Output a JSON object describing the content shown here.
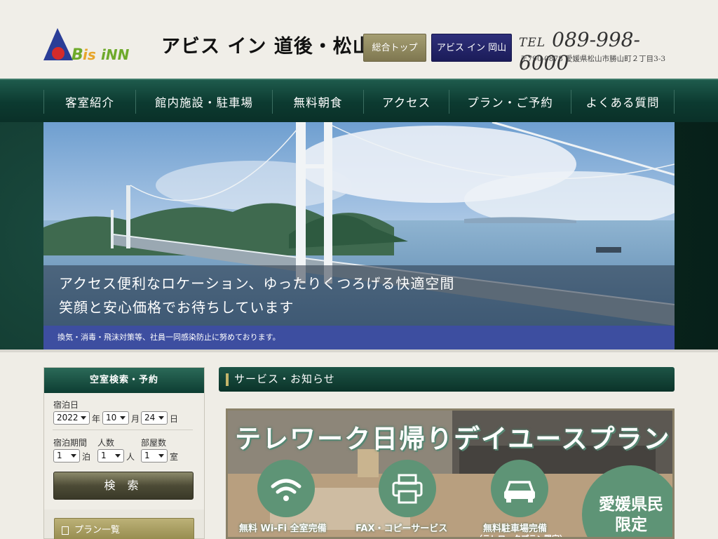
{
  "header": {
    "logo_text": "アビス イン 道後・松山",
    "logo_mark": "ABiS iNN",
    "btn_top": "総合トップ",
    "btn_okayama": "アビス イン 岡山",
    "tel_label": "TEL",
    "tel_number": "089-998-6000",
    "address": "〒790-0878  愛媛県松山市勝山町２丁目3-3"
  },
  "nav": {
    "items": [
      {
        "label": "客室紹介"
      },
      {
        "label": "館内施設・駐車場"
      },
      {
        "label": "無料朝食"
      },
      {
        "label": "アクセス"
      },
      {
        "label": "プラン・ご予約"
      },
      {
        "label": "よくある質問"
      }
    ]
  },
  "hero": {
    "line1": "アクセス便利なロケーション、ゆったりくつろげる快適空間",
    "line2": "笑顔と安心価格でお待ちしています",
    "notice": "換気・消毒・飛沫対策等、社員一同感染防止に努めております。"
  },
  "sidebar": {
    "title": "空室検索・予約",
    "checkin_label": "宿泊日",
    "year": "2022",
    "year_unit": "年",
    "month": "10",
    "month_unit": "月",
    "day": "24",
    "day_unit": "日",
    "nights_label": "宿泊期間",
    "nights": "1",
    "nights_unit": "泊",
    "people_label": "人数",
    "people": "1",
    "people_unit": "人",
    "rooms_label": "部屋数",
    "rooms": "1",
    "rooms_unit": "室",
    "search_button": "検 索",
    "plan_list": "プラン一覧"
  },
  "main": {
    "section_title": "サービス・お知らせ",
    "banner": {
      "title": "テレワーク日帰りデイユースプラン",
      "feature1": "無料 Wi-Fi 全室完備",
      "feature2": "FAX・コピーサービス",
      "feature3": "無料駐車場完備",
      "feature3_sub": "（テレワークプラン限定）",
      "ehime_line1": "愛媛県民",
      "ehime_line2": "限定"
    }
  },
  "colors": {
    "nav_green": "#0c3a30",
    "accent_gold": "#958b4e",
    "notice_blue": "#3d4ea0",
    "okayama_navy": "#1b1c59",
    "banner_green": "#5e9476"
  }
}
